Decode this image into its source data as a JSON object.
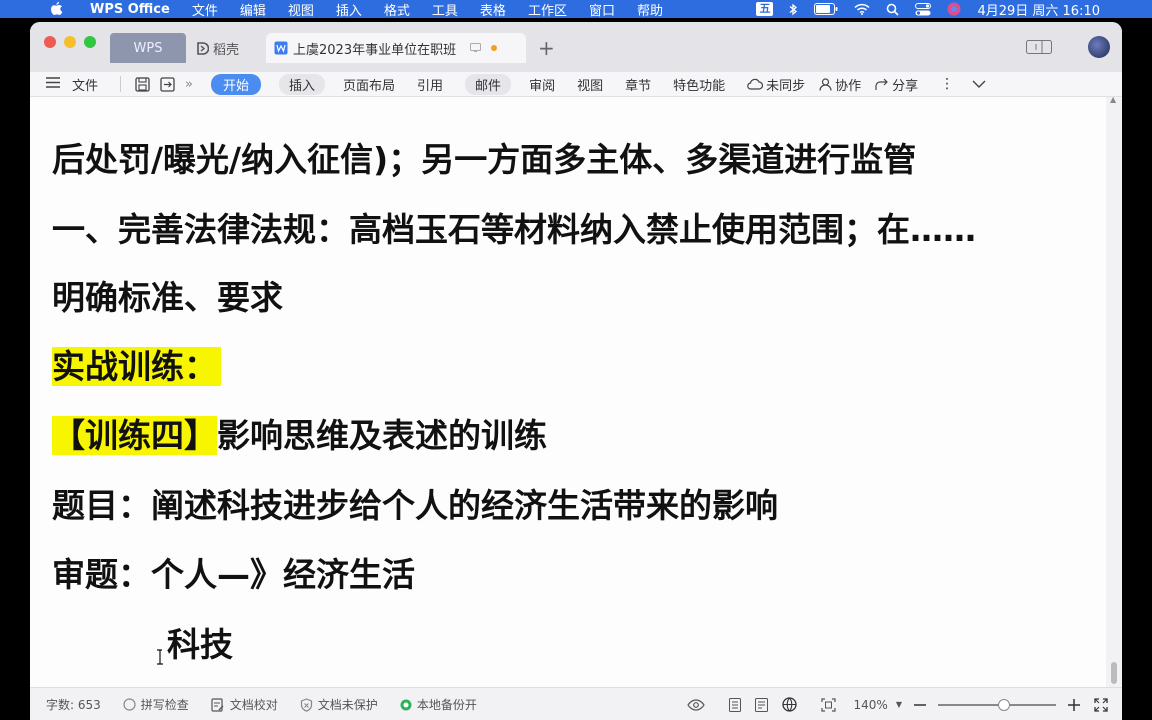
{
  "menubar": {
    "app_name": "WPS Office",
    "items": [
      "文件",
      "编辑",
      "视图",
      "插入",
      "格式",
      "工具",
      "表格",
      "工作区",
      "窗口",
      "帮助"
    ],
    "input_method": "五",
    "clock": "4月29日 周六 16:10"
  },
  "tabs": {
    "wps": "WPS",
    "daoke": "稻壳",
    "doc_title": "上虞2023年事业单位在职班"
  },
  "ribbon": {
    "file": "文件",
    "tabs": [
      "开始",
      "插入",
      "页面布局",
      "引用",
      "邮件",
      "审阅",
      "视图",
      "章节",
      "特色功能"
    ],
    "sync": "未同步",
    "collab": "协作",
    "share": "分享"
  },
  "document": {
    "line0": "后处罚/曝光/纳入征信)；另一方面多主体、多渠道进行监管",
    "line1": "一、完善法律法规：高档玉石等材料纳入禁止使用范围；在……",
    "line2": "明确标准、要求",
    "line3": "实战训练：",
    "line4_hl": "【训练四】",
    "line4_rest": "影响思维及表述的训练",
    "line5": "题目：阐述科技进步给个人的经济生活带来的影响",
    "line6": "审题：个人—》经济生活",
    "line7": "科技"
  },
  "status": {
    "word_count": "字数: 653",
    "spell_check": "拼写检查",
    "doc_proof": "文档校对",
    "protect": "文档未保护",
    "backup": "本地备份开",
    "zoom": "140%"
  }
}
